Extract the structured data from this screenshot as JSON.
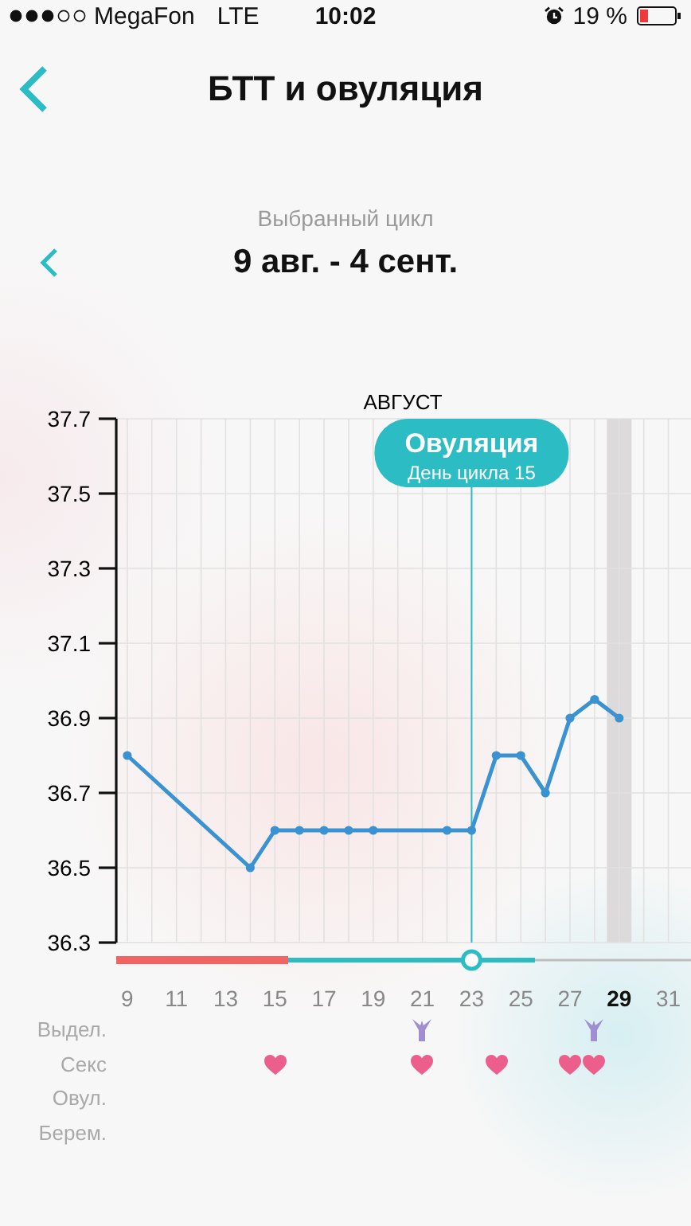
{
  "status_bar": {
    "carrier": "MegaFon",
    "network": "LTE",
    "time": "10:02",
    "battery": "19 %"
  },
  "nav": {
    "title": "БТТ и овуляция"
  },
  "cycle": {
    "caption": "Выбранный цикл",
    "range": "9 авг. - 4 сент."
  },
  "chart": {
    "chart_data": {
      "type": "line",
      "title": "АВГУСТ",
      "x": [
        9,
        14,
        15,
        16,
        17,
        18,
        19,
        22,
        23,
        24,
        25,
        26,
        27,
        28,
        29
      ],
      "series": [
        {
          "color": "#3a93d0",
          "values": [
            36.8,
            36.5,
            36.6,
            36.6,
            36.6,
            36.6,
            36.6,
            36.6,
            36.6,
            36.8,
            36.8,
            36.7,
            36.9,
            36.95,
            36.9
          ]
        }
      ],
      "marker": "o",
      "grid": true,
      "xlim": [
        8.55,
        31.92
      ],
      "ylim": [
        36.3,
        37.7
      ],
      "xticks": [
        9,
        11,
        13,
        15,
        17,
        19,
        21,
        23,
        25,
        27,
        29,
        31
      ],
      "yticks": [
        36.3,
        36.5,
        36.7,
        36.9,
        37.1,
        37.3,
        37.5,
        37.7
      ],
      "bands": [
        {
          "axis": "x",
          "from": 28.5,
          "to": 29.5
        }
      ],
      "ref_lines": [
        {
          "axis": "x",
          "value": 23
        }
      ],
      "annotations": [
        "Овуляция",
        "День цикла 15"
      ]
    }
  },
  "marks": [
    {
      "label": "Выдел.",
      "kind": "discharge",
      "days": [
        false,
        false,
        false,
        false,
        false,
        false,
        false,
        false,
        false,
        false,
        false,
        false,
        true,
        false,
        false,
        false,
        false,
        false,
        false,
        true,
        false,
        false,
        false
      ]
    },
    {
      "label": "Секс",
      "kind": "sex",
      "days": [
        false,
        false,
        false,
        false,
        false,
        false,
        true,
        false,
        false,
        false,
        false,
        false,
        true,
        false,
        false,
        true,
        false,
        false,
        true,
        true,
        false,
        false,
        false
      ]
    },
    {
      "label": "Овул.",
      "days": [
        false,
        false,
        false,
        false,
        false,
        false,
        false,
        false,
        false,
        false,
        false,
        false,
        false,
        false,
        false,
        false,
        false,
        false,
        false,
        false,
        false,
        false,
        false
      ]
    },
    {
      "label": "Берем.",
      "days": [
        false,
        false,
        false,
        false,
        false,
        false,
        false,
        false,
        false,
        false,
        false,
        false,
        false,
        false,
        false,
        false,
        false,
        false,
        false,
        false,
        false,
        false,
        false
      ]
    }
  ]
}
